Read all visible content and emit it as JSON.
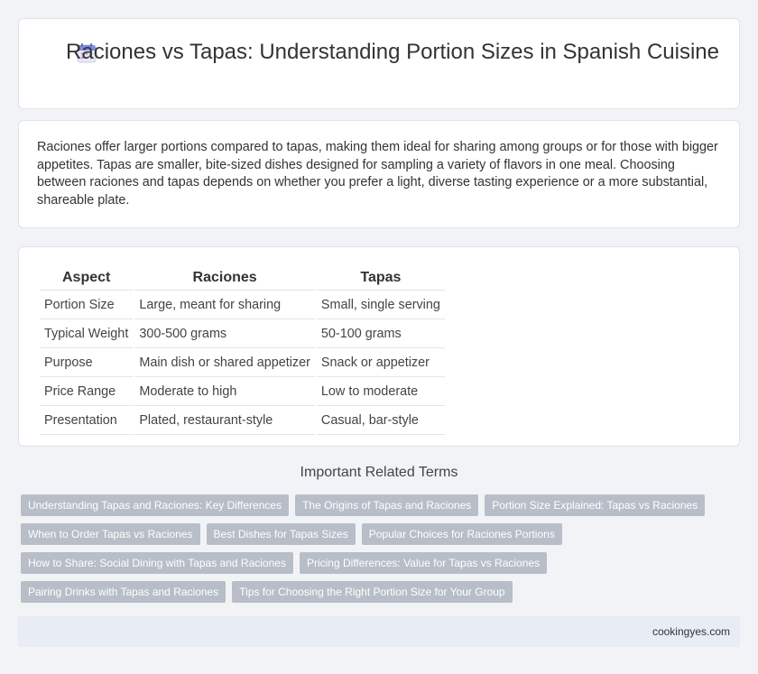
{
  "header": {
    "title": "Raciones vs Tapas: Understanding Portion Sizes in Spanish Cuisine",
    "icon": "calendar-icon"
  },
  "intro": {
    "text": "Raciones offer larger portions compared to tapas, making them ideal for sharing among groups or for those with bigger appetites. Tapas are smaller, bite-sized dishes designed for sampling a variety of flavors in one meal. Choosing between raciones and tapas depends on whether you prefer a light, diverse tasting experience or a more substantial, shareable plate."
  },
  "table": {
    "headers": [
      "Aspect",
      "Raciones",
      "Tapas"
    ],
    "rows": [
      [
        "Portion Size",
        "Large, meant for sharing",
        "Small, single serving"
      ],
      [
        "Typical Weight",
        "300-500 grams",
        "50-100 grams"
      ],
      [
        "Purpose",
        "Main dish or shared appetizer",
        "Snack or appetizer"
      ],
      [
        "Price Range",
        "Moderate to high",
        "Low to moderate"
      ],
      [
        "Presentation",
        "Plated, restaurant-style",
        "Casual, bar-style"
      ]
    ]
  },
  "related": {
    "title": "Important Related Terms",
    "tags": [
      "Understanding Tapas and Raciones: Key Differences",
      "The Origins of Tapas and Raciones",
      "Portion Size Explained: Tapas vs Raciones",
      "When to Order Tapas vs Raciones",
      "Best Dishes for Tapas Sizes",
      "Popular Choices for Raciones Portions",
      "How to Share: Social Dining with Tapas and Raciones",
      "Pricing Differences: Value for Tapas vs Raciones",
      "Pairing Drinks with Tapas and Raciones",
      "Tips for Choosing the Right Portion Size for Your Group"
    ]
  },
  "footer": {
    "site": "cookingyes.com"
  },
  "colors": {
    "background": "#f1f3f7",
    "tag_bg": "#b8bec7",
    "footer_bg": "#e8ecf4"
  }
}
